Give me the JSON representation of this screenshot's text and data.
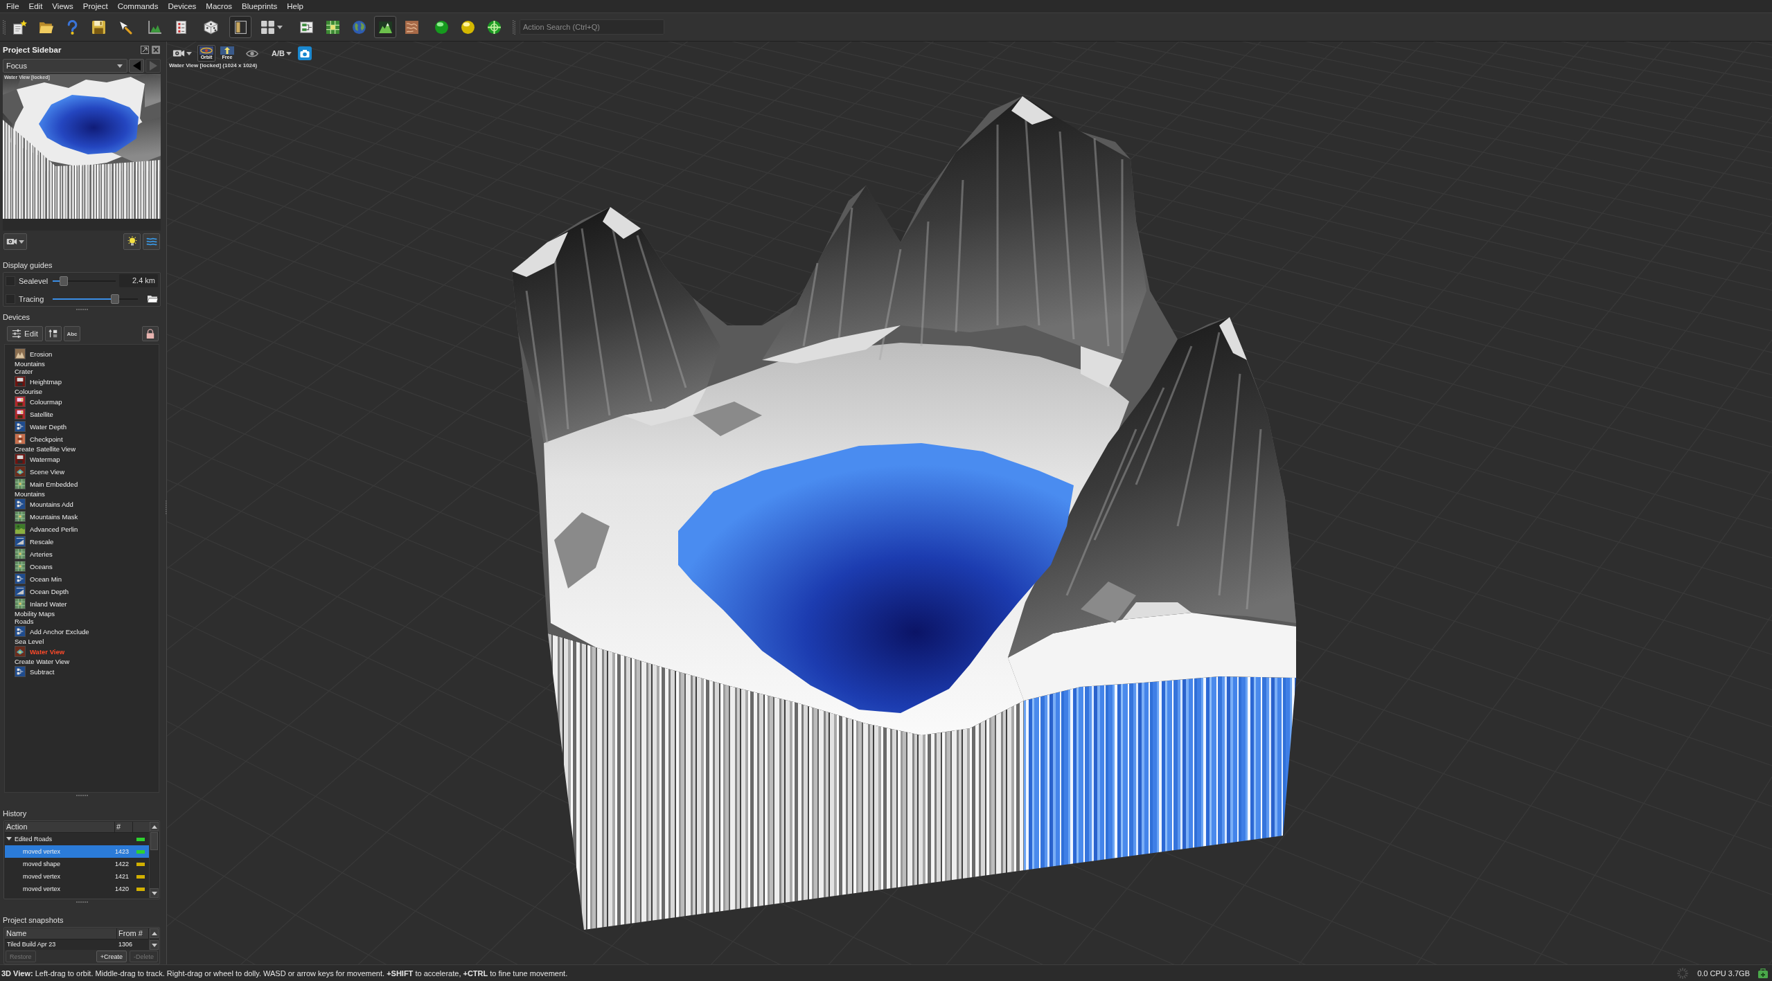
{
  "menu_bar": {
    "items": [
      "File",
      "Edit",
      "Views",
      "Project",
      "Commands",
      "Devices",
      "Macros",
      "Blueprints",
      "Help"
    ]
  },
  "toolbar": {
    "groups": [
      {
        "buttons": [
          {
            "kind": "newfile",
            "on": false
          },
          {
            "kind": "open",
            "on": false
          },
          {
            "kind": "help",
            "on": false
          },
          {
            "kind": "save",
            "on": false
          },
          {
            "kind": "import",
            "on": false
          }
        ]
      },
      {
        "buttons": [
          {
            "kind": "graph",
            "on": false
          },
          {
            "kind": "checklist",
            "on": false
          }
        ]
      },
      {
        "buttons": [
          {
            "kind": "dice",
            "on": false
          }
        ]
      },
      {
        "buttons": [
          {
            "kind": "panel",
            "on": true
          },
          {
            "kind": "layout",
            "on": false
          }
        ]
      },
      {
        "buttons": [
          {
            "kind": "device",
            "on": false
          },
          {
            "kind": "tiles",
            "on": false
          },
          {
            "kind": "globe",
            "on": false
          },
          {
            "kind": "terrain",
            "on": true
          },
          {
            "kind": "texture",
            "on": false
          }
        ]
      },
      {
        "buttons": [
          {
            "kind": "orb",
            "on": false
          },
          {
            "kind": "orbalt",
            "on": false
          },
          {
            "kind": "orbgrid",
            "on": false
          }
        ]
      }
    ],
    "search": {
      "placeholder": "Action Search (Ctrl+Q)"
    }
  },
  "sidebar": {
    "title": "Project Sidebar",
    "focus": {
      "value": "Focus",
      "nav": [
        {
          "kind": "back",
          "disabled": false
        },
        {
          "kind": "forward",
          "disabled": true
        }
      ]
    },
    "preview": {
      "caption": "Water View [locked]",
      "buttons": [
        {
          "kind": "camera"
        },
        {
          "kind": "light"
        },
        {
          "kind": "water"
        }
      ]
    },
    "display_guides": {
      "title": "Display guides",
      "guides": [
        {
          "kind": "value",
          "label": "Sealevel",
          "checked": false,
          "level": 0.18,
          "value": "2.4 km"
        },
        {
          "kind": "file",
          "label": "Tracing",
          "checked": false,
          "level": 0.73
        }
      ]
    },
    "devices": {
      "title": "Devices",
      "toolbar": [
        {
          "kind": "edit",
          "label": "Edit"
        },
        {
          "kind": "sort"
        },
        {
          "kind": "text",
          "label": "Abc"
        },
        {
          "kind": "lock"
        }
      ],
      "items": [
        {
          "kind": "erosion",
          "label": "Erosion",
          "selected": false
        },
        {
          "kind": "group",
          "label": "Mountains",
          "selected": false
        },
        {
          "kind": "group",
          "label": "Crater",
          "selected": false
        },
        {
          "kind": "export",
          "label": "Heightmap",
          "selected": false
        },
        {
          "kind": "group",
          "label": "Colourise",
          "selected": false
        },
        {
          "kind": "exportcolor",
          "label": "Colourmap",
          "selected": false
        },
        {
          "kind": "exportcolor",
          "label": "Satellite",
          "selected": false
        },
        {
          "kind": "math",
          "label": "Water Depth",
          "selected": false
        },
        {
          "kind": "checkpoint",
          "label": "Checkpoint",
          "selected": false
        },
        {
          "kind": "group",
          "label": "Create Satellite View",
          "selected": false
        },
        {
          "kind": "export",
          "label": "Watermap",
          "selected": false
        },
        {
          "kind": "view",
          "label": "Scene View",
          "selected": false
        },
        {
          "kind": "map",
          "label": "Main Embedded",
          "selected": false
        },
        {
          "kind": "group",
          "label": "Mountains",
          "selected": false
        },
        {
          "kind": "math",
          "label": "Mountains Add",
          "selected": false
        },
        {
          "kind": "map",
          "label": "Mountains Mask",
          "selected": false
        },
        {
          "kind": "perlin",
          "label": "Advanced Perlin",
          "selected": false
        },
        {
          "kind": "rescale",
          "label": "Rescale",
          "selected": false
        },
        {
          "kind": "map",
          "label": "Arteries",
          "selected": false
        },
        {
          "kind": "map",
          "label": "Oceans",
          "selected": false
        },
        {
          "kind": "math",
          "label": "Ocean Min",
          "selected": false
        },
        {
          "kind": "rescale",
          "label": "Ocean Depth",
          "selected": false
        },
        {
          "kind": "map",
          "label": "Inland Water",
          "selected": false
        },
        {
          "kind": "group",
          "label": "Mobility Maps",
          "selected": false
        },
        {
          "kind": "group",
          "label": "Roads",
          "selected": false
        },
        {
          "kind": "math",
          "label": "Add Anchor Exclude",
          "selected": false
        },
        {
          "kind": "group",
          "label": "Sea Level",
          "selected": false
        },
        {
          "kind": "view",
          "label": "Water View",
          "selected": true
        },
        {
          "kind": "group",
          "label": "Create Water View",
          "selected": false
        },
        {
          "kind": "math",
          "label": "Subtract",
          "selected": false
        }
      ]
    },
    "history": {
      "title": "History",
      "columns": [
        "Action",
        "#"
      ],
      "rows": [
        {
          "action": "Edited Roads",
          "expanded": true,
          "selected": false,
          "color": "#2ed12e",
          "children": [
            {
              "action": "moved vertex",
              "number": "1423",
              "selected": true,
              "color": "#2ed12e"
            },
            {
              "action": "moved shape",
              "number": "1422",
              "selected": false,
              "color": "#d2b000"
            },
            {
              "action": "moved vertex",
              "number": "1421",
              "selected": false,
              "color": "#d2b000"
            },
            {
              "action": "moved vertex",
              "number": "1420",
              "selected": false,
              "color": "#d2b000"
            }
          ]
        }
      ]
    },
    "snapshots": {
      "title": "Project snapshots",
      "columns": [
        "Name",
        "From #"
      ],
      "rows": [
        {
          "name": "Tiled Build Apr 23",
          "from": "1306",
          "selected": false
        }
      ],
      "buttons": [
        {
          "label": "Restore",
          "disabled": true
        },
        {
          "label": "+Create",
          "disabled": false
        },
        {
          "label": "-Delete",
          "disabled": true
        }
      ]
    }
  },
  "viewport": {
    "toolbar": [
      {
        "kind": "camera",
        "on": false
      },
      {
        "kind": "orbit",
        "label": "Orbit",
        "on": true
      },
      {
        "kind": "free",
        "label": "Free",
        "on": false
      },
      {
        "kind": "eye",
        "on": false
      },
      {
        "kind": "compare",
        "label": "A/B",
        "on": false
      },
      {
        "kind": "snapshot",
        "on": false
      }
    ],
    "caption": "Water View [locked] (1024 x 1024)"
  },
  "status_bar": {
    "hint": "**3D View:** Left-drag to orbit. Middle-drag to track. Right-drag or wheel to dolly. WASD or arrow keys for movement. **+SHIFT** to accelerate, **+CTRL** to fine tune movement.",
    "stats": "0.0 CPU 3.7GB"
  }
}
